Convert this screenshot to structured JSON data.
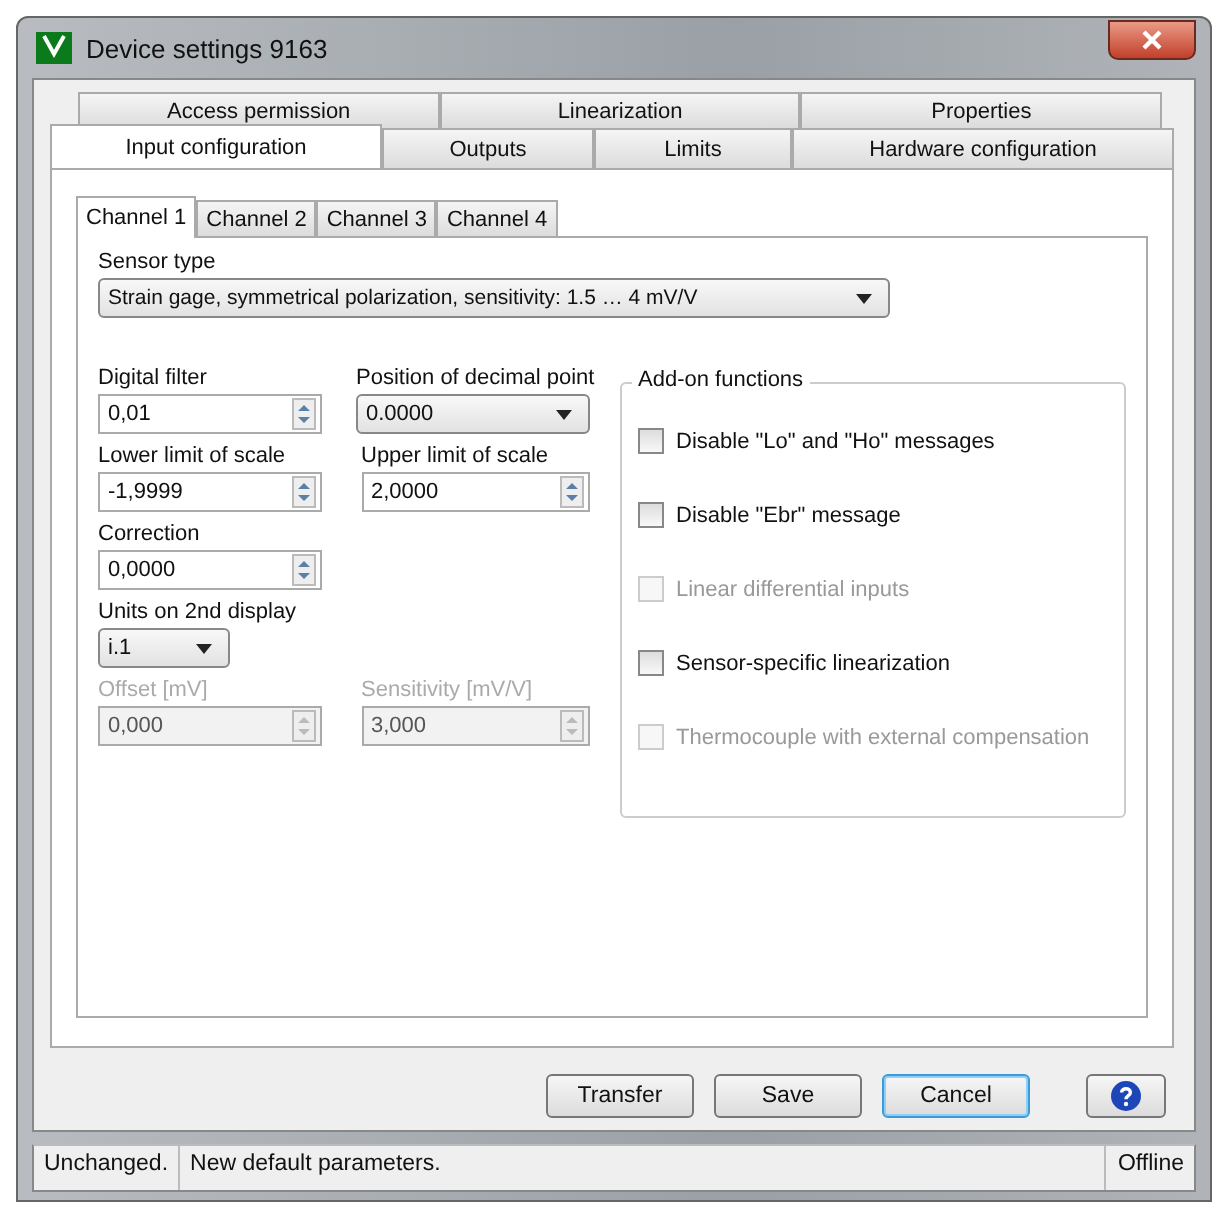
{
  "window": {
    "title": "Device settings 9163"
  },
  "tabs_back_row": [
    {
      "label": "Access permission",
      "selected": false
    },
    {
      "label": "Linearization",
      "selected": false
    },
    {
      "label": "Properties",
      "selected": false
    }
  ],
  "tabs_front_row": [
    {
      "label": "Input configuration",
      "selected": true
    },
    {
      "label": "Outputs",
      "selected": false
    },
    {
      "label": "Limits",
      "selected": false
    },
    {
      "label": "Hardware configuration",
      "selected": false
    }
  ],
  "channel_tabs": [
    {
      "label": "Channel 1",
      "selected": true
    },
    {
      "label": "Channel 2",
      "selected": false
    },
    {
      "label": "Channel 3",
      "selected": false
    },
    {
      "label": "Channel 4",
      "selected": false
    }
  ],
  "sensor_type": {
    "label": "Sensor type",
    "value": "Strain gage, symmetrical polarization, sensitivity: 1.5 … 4 mV/V"
  },
  "field_rows": [
    [
      {
        "label": "Digital filter",
        "value": "0,01",
        "kind": "spin",
        "disabled": false
      },
      {
        "label": "Position of decimal point",
        "value": "0.0000",
        "kind": "combo",
        "disabled": false
      }
    ],
    [
      {
        "label": "Lower limit of scale",
        "value": "-1,9999",
        "kind": "spin",
        "disabled": false
      },
      {
        "label": "Upper limit of scale",
        "value": "2,0000",
        "kind": "spin",
        "disabled": false
      }
    ],
    [
      {
        "label": "Correction",
        "value": "0,0000",
        "kind": "spin",
        "disabled": false
      }
    ],
    [
      {
        "label": "Units on 2nd display",
        "value": "i.1",
        "kind": "small_combo",
        "disabled": false
      }
    ],
    [
      {
        "label": "Offset [mV]",
        "value": "0,000",
        "kind": "spin",
        "disabled": true
      },
      {
        "label": "Sensitivity [mV/V]",
        "value": "3,000",
        "kind": "spin",
        "disabled": true
      }
    ]
  ],
  "addon": {
    "title": "Add-on functions",
    "options": [
      {
        "label": "Disable \"Lo\" and \"Ho\" messages",
        "checked": false,
        "disabled": false
      },
      {
        "label": "Disable \"Ebr\" message",
        "checked": false,
        "disabled": false
      },
      {
        "label": "Linear differential inputs",
        "checked": false,
        "disabled": true
      },
      {
        "label": "Sensor-specific linearization",
        "checked": false,
        "disabled": false
      },
      {
        "label": "Thermocouple with external compensation",
        "checked": false,
        "disabled": true
      }
    ]
  },
  "buttons": [
    {
      "label": "Transfer",
      "kind": "text",
      "focused": false
    },
    {
      "label": "Save",
      "kind": "text",
      "focused": false
    },
    {
      "label": "Cancel",
      "kind": "text",
      "focused": true
    },
    {
      "kind": "help",
      "focused": false
    }
  ],
  "status_bar": [
    "Unchanged.",
    "New default parameters.",
    "Offline"
  ]
}
